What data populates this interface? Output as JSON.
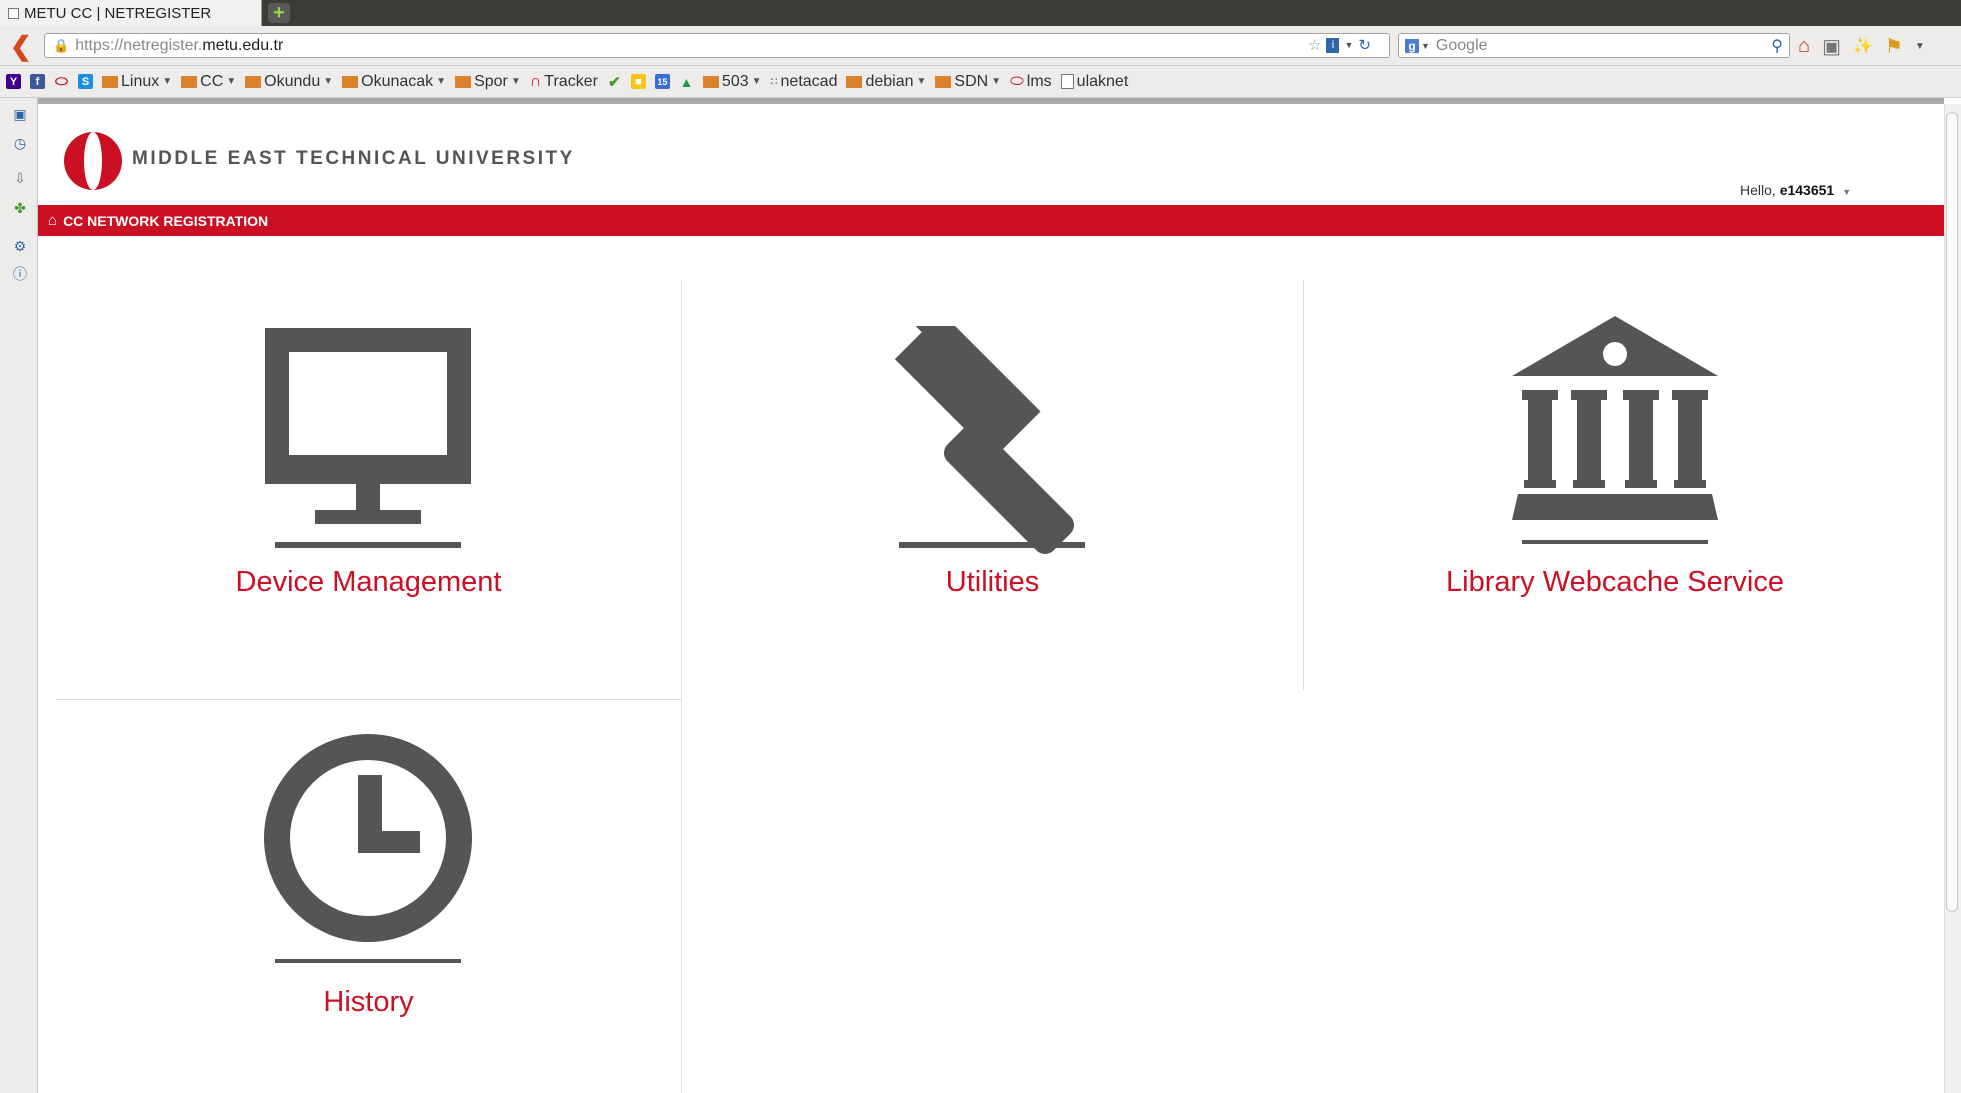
{
  "browser": {
    "tab_title": "METU CC | NETREGISTER",
    "new_tab_symbol": "+",
    "url_prefix": "https://netregister.",
    "url_host": "metu.edu.tr",
    "search_placeholder": "Google"
  },
  "bookmarks": [
    {
      "label": "Linux",
      "type": "folder"
    },
    {
      "label": "CC",
      "type": "folder"
    },
    {
      "label": "Okundu",
      "type": "folder"
    },
    {
      "label": "Okunacak",
      "type": "folder"
    },
    {
      "label": "Spor",
      "type": "folder"
    },
    {
      "label": "Tracker",
      "type": "link"
    },
    {
      "label": "503",
      "type": "folder"
    },
    {
      "label": "netacad",
      "type": "link"
    },
    {
      "label": "debian",
      "type": "folder"
    },
    {
      "label": "SDN",
      "type": "folder"
    },
    {
      "label": "lms",
      "type": "link"
    },
    {
      "label": "ulaknet",
      "type": "link"
    }
  ],
  "site": {
    "university_name": "MIDDLE EAST TECHNICAL UNIVERSITY",
    "greeting": "Hello,",
    "username": "e143651",
    "section_title": "CC NETWORK REGISTRATION",
    "accent_color": "#cc1024",
    "icon_color": "#555555"
  },
  "tiles": [
    {
      "label": "Device Management",
      "icon": "monitor-icon"
    },
    {
      "label": "Utilities",
      "icon": "hammer-icon"
    },
    {
      "label": "Library Webcache Service",
      "icon": "library-building-icon"
    },
    {
      "label": "History",
      "icon": "clock-icon"
    }
  ]
}
